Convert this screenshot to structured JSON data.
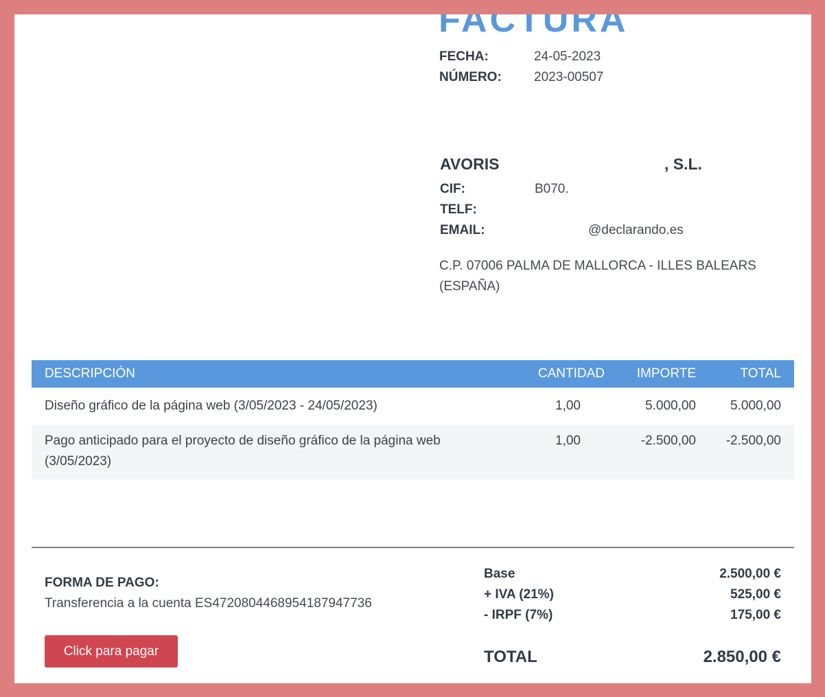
{
  "invoice": {
    "title": "FACTURA",
    "date_label": "FECHA:",
    "date": "24-05-2023",
    "number_label": "NÚMERO:",
    "number": "2023-00507"
  },
  "client": {
    "name_start": "AVORIS",
    "name_end": ", S.L.",
    "cif_label": "CIF:",
    "cif": "B070.",
    "phone_label": "TELF:",
    "phone": "",
    "email_label": "EMAIL:",
    "email": "@declarando.es",
    "address": "C.P. 07006 PALMA DE MALLORCA - ILLES BALEARS (ESPAÑA)"
  },
  "table": {
    "headers": {
      "description": "DESCRIPCIÓN",
      "quantity": "CANTIDAD",
      "amount": "IMPORTE",
      "total": "TOTAL"
    },
    "rows": [
      {
        "description": "Diseño gráfico de la página web (3/05/2023 - 24/05/2023)",
        "quantity": "1,00",
        "amount": "5.000,00",
        "total": "5.000,00"
      },
      {
        "description": "Pago anticipado para el proyecto de diseño gráfico de la página web (3/05/2023)",
        "quantity": "1,00",
        "amount": "-2.500,00",
        "total": "-2.500,00"
      }
    ]
  },
  "payment": {
    "label": "FORMA DE PAGO:",
    "text": "Transferencia a la cuenta ES4720804468954187947736",
    "button": "Click para pagar"
  },
  "summary": {
    "base_label": "Base",
    "base_value": "2.500,00 €",
    "iva_label": "+ IVA (21%)",
    "iva_value": "525,00 €",
    "irpf_label": "- IRPF (7%)",
    "irpf_value": "175,00 €",
    "total_label": "TOTAL",
    "total_value": "2.850,00 €"
  },
  "colors": {
    "background": "#de7f7f",
    "accent": "#5a98dd",
    "button": "#cf4550"
  }
}
